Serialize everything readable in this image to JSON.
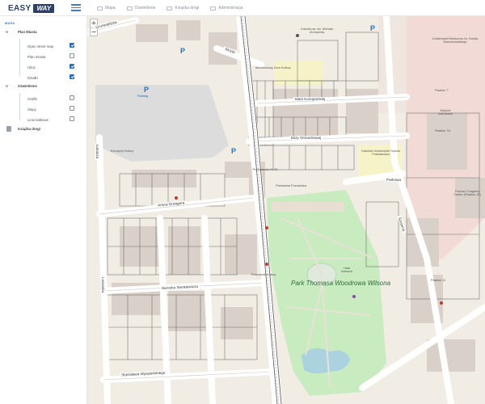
{
  "app": {
    "logo_primary": "EASY",
    "logo_secondary": "WAY"
  },
  "nav": [
    {
      "label": "Mapa",
      "icon": "map-icon"
    },
    {
      "label": "Oświetlenie",
      "icon": "lamp-icon"
    },
    {
      "label": "Książka drogi",
      "icon": "book-icon"
    },
    {
      "label": "Administracja",
      "icon": "admin-icon"
    }
  ],
  "sidebar": {
    "header": "MAPA",
    "plan": {
      "title": "Plan Miasta",
      "items": [
        {
          "label": "Open street map",
          "checked": true
        },
        {
          "label": "Plan miasta",
          "checked": false
        },
        {
          "label": "Ulica",
          "checked": true
        },
        {
          "label": "Działki",
          "checked": true
        }
      ]
    },
    "lighting": {
      "title": "Oświetlenie",
      "items": [
        {
          "label": "Szafki",
          "checked": false
        },
        {
          "label": "Słupy",
          "checked": false
        },
        {
          "label": "Linie kablowe",
          "checked": false
        }
      ]
    },
    "road_book": "Książka drogi"
  },
  "map": {
    "zoom_in": "+",
    "zoom_out": "−",
    "streets": {
      "grunwaldzka": "Grunwaldzka",
      "skryta": "Skryta",
      "marii": "Marii Konopnickiej",
      "elizy": "Elizy Orzeszkowej",
      "artura": "Artura Grottgera",
      "henryka": "Henryka Sienkiewicza",
      "stanislawa": "Stanisława Wyspiańskiego",
      "lwowska": "Lwowska",
      "parkowa": "Parkowa",
      "szopena": "Szopena",
      "lukasza": "Łukasza"
    },
    "pois": {
      "parking": "Parking",
      "park_name": "Park Thomasa Woodrowa Wilsona",
      "kosciol": "Kościół pw. św. Michała Archanioła",
      "uniwersytet": "Uniwersytet Medyczny im. Karola Marcinkowskiego",
      "pawilon7": "Pawilon 7",
      "wejscie": "Wejście Zachodnie",
      "pawilon7a": "Pawilon 7A",
      "poznan_center": "Poznań Congress Center (Pawilon 15)",
      "pawilon11": "Pawilon 11",
      "koncepty": "Koncepty Kultury",
      "palmiarnia": "Palmiarnia Poznańska",
      "hala": "Hala Ikebana",
      "szkola": "Katolicki Uniwersytet Szkoła Podstawowa",
      "przedszkole": "Przedszkole Nr 30",
      "mlodziezowy": "Młodzieżowy Dom Kultury",
      "pracownia": "Pracownia Kultury"
    }
  },
  "colors": {
    "accent": "#3f7cc0",
    "brand": "#2a3f6a",
    "park": "#c8ebc0",
    "building": "#d9d0c9",
    "road": "#ffffff"
  }
}
